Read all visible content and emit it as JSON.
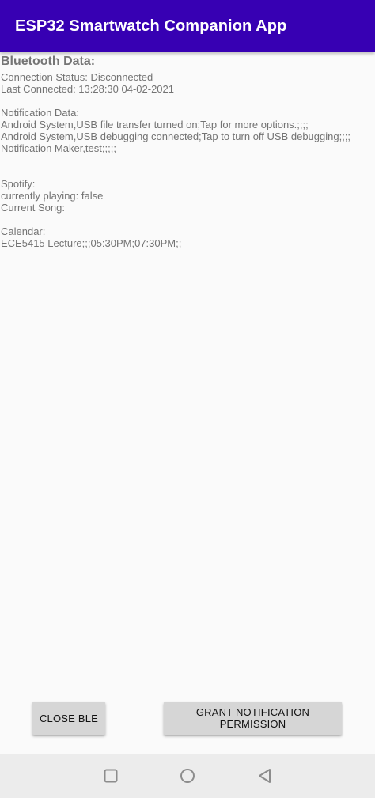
{
  "app_bar": {
    "title": "ESP32 Smartwatch Companion App",
    "background_color": "#3700b3"
  },
  "bluetooth": {
    "heading": "Bluetooth Data:",
    "connection_status": "Connection Status: Disconnected",
    "last_connected": "Last Connected: 13:28:30 04-02-2021"
  },
  "notifications": {
    "heading": "Notification Data:",
    "items": [
      "Android System,USB file transfer turned on;Tap for more options.;;;;",
      "Android System,USB debugging connected;Tap to turn off USB debugging;;;;",
      "Notification Maker,test;;;;;"
    ]
  },
  "spotify": {
    "heading": "Spotify:",
    "playing": "currently playing: false",
    "current_song": "Current Song:"
  },
  "calendar": {
    "heading": "Calendar:",
    "event": "ECE5415 Lecture;;;05:30PM;07:30PM;;"
  },
  "buttons": {
    "close_ble": "CLOSE BLE",
    "grant_permission": "GRANT NOTIFICATION PERMISSION"
  },
  "nav_bar": {
    "icons": [
      "square-recents-icon",
      "circle-home-icon",
      "triangle-back-icon"
    ]
  }
}
